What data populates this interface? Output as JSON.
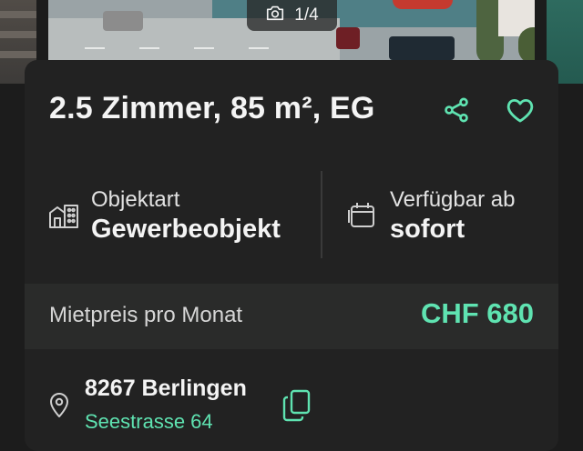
{
  "gallery": {
    "counter": "1/4",
    "camera_icon": "camera-icon"
  },
  "listing": {
    "title": "2.5 Zimmer, 85 m², EG",
    "share_icon": "share-icon",
    "favorite_icon": "heart-icon"
  },
  "facts": [
    {
      "label": "Objektart",
      "value": "Gewerbeobjekt",
      "icon": "building-icon"
    },
    {
      "label": "Verfügbar ab",
      "value": "sofort",
      "icon": "calendar-icon"
    }
  ],
  "price": {
    "label": "Mietpreis pro Monat",
    "value": "CHF 680"
  },
  "address": {
    "city": "8267 Berlingen",
    "street": "Seestrasse 64",
    "pin_icon": "location-pin-icon",
    "copy_icon": "copy-icon"
  },
  "colors": {
    "accent": "#5fe3b1",
    "background": "#1c1c1c",
    "card": "#222222",
    "price_row": "#2a2b2a"
  }
}
